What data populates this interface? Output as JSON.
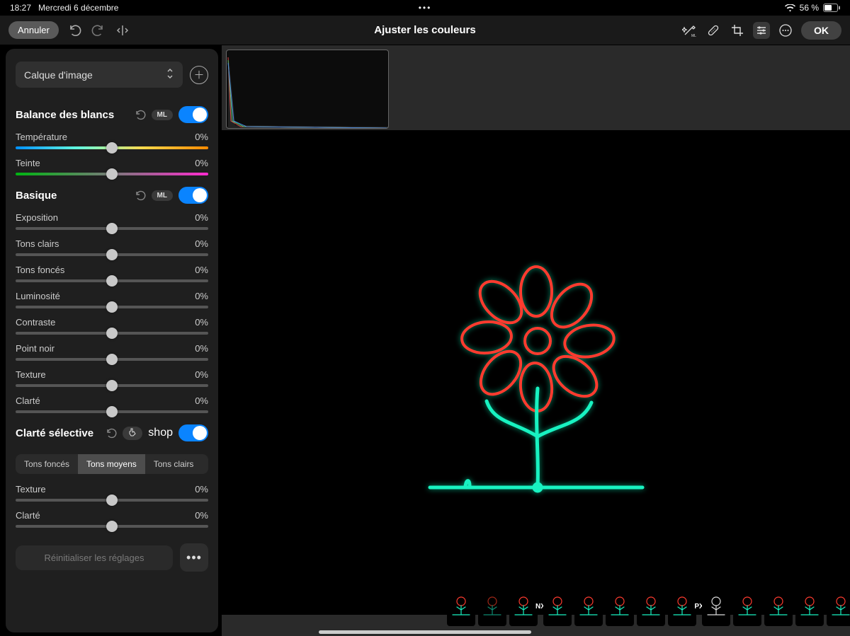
{
  "status": {
    "time": "18:27",
    "date": "Mercredi 6 décembre",
    "battery": "56 %"
  },
  "toolbar": {
    "cancel": "Annuler",
    "title": "Ajuster les couleurs",
    "ok": "OK"
  },
  "sidebar": {
    "layer_label": "Calque d'image",
    "white_balance": {
      "title": "Balance des blancs",
      "ml": "ML"
    },
    "temperature": {
      "label": "Température",
      "value": "0%"
    },
    "tint": {
      "label": "Teinte",
      "value": "0%"
    },
    "basic": {
      "title": "Basique",
      "ml": "ML"
    },
    "exposure": {
      "label": "Exposition",
      "value": "0%"
    },
    "highlights": {
      "label": "Tons clairs",
      "value": "0%"
    },
    "shadows": {
      "label": "Tons foncés",
      "value": "0%"
    },
    "brightness": {
      "label": "Luminosité",
      "value": "0%"
    },
    "contrast": {
      "label": "Contraste",
      "value": "0%"
    },
    "blackpoint": {
      "label": "Point noir",
      "value": "0%"
    },
    "texture": {
      "label": "Texture",
      "value": "0%"
    },
    "clarity": {
      "label": "Clarté",
      "value": "0%"
    },
    "sel_clarity": {
      "title": "Clarté sélective"
    },
    "seg": {
      "shadows": "Tons foncés",
      "mid": "Tons moyens",
      "high": "Tons clairs"
    },
    "texture2": {
      "label": "Texture",
      "value": "0%"
    },
    "clarity2": {
      "label": "Clarté",
      "value": "0%"
    },
    "reset": "Réinitialiser les réglages"
  },
  "filmstrip": {
    "nx": "NX",
    "px": "PX"
  }
}
